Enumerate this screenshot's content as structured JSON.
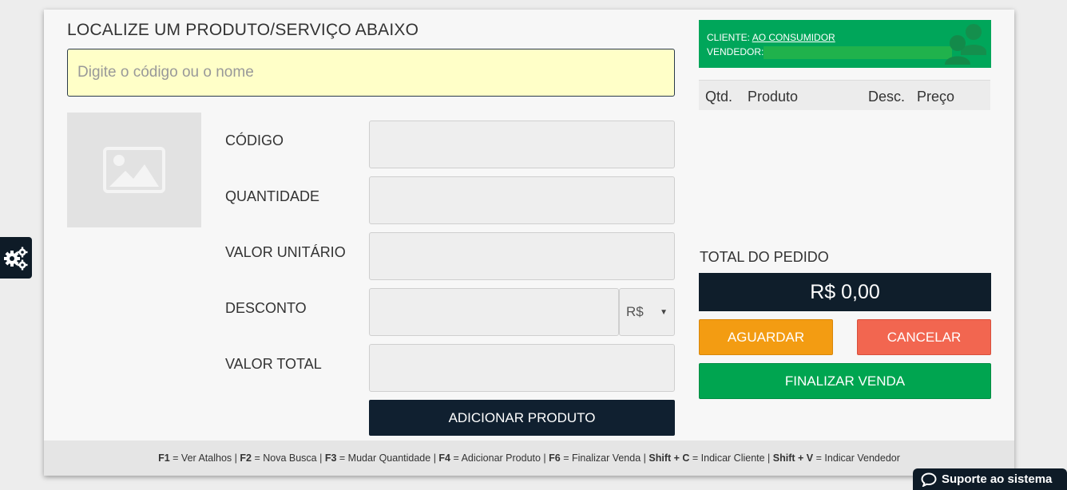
{
  "search": {
    "title": "LOCALIZE UM PRODUTO/SERVIÇO ABAIXO",
    "placeholder": "Digite o código ou o nome"
  },
  "fields": {
    "code_label": "CÓDIGO",
    "quantity_label": "QUANTIDADE",
    "unit_value_label": "VALOR UNITÁRIO",
    "discount_label": "DESCONTO",
    "total_value_label": "VALOR TOTAL",
    "discount_currency": "R$"
  },
  "add_button": "ADICIONAR PRODUTO",
  "client": {
    "client_label": "CLIENTE:",
    "client_name": "AO CONSUMIDOR",
    "seller_label": "VENDEDOR:"
  },
  "cart": {
    "columns": [
      "Qtd.",
      "Produto",
      "Desc.",
      "Preço"
    ]
  },
  "order": {
    "total_label": "TOTAL DO PEDIDO",
    "total_value": "R$ 0,00"
  },
  "buttons": {
    "wait": "AGUARDAR",
    "cancel": "CANCELAR",
    "finish": "FINALIZAR VENDA"
  },
  "shortcuts": [
    {
      "key": "F1",
      "desc": "Ver Atalhos"
    },
    {
      "key": "F2",
      "desc": "Nova Busca"
    },
    {
      "key": "F3",
      "desc": "Mudar Quantidade"
    },
    {
      "key": "F4",
      "desc": "Adicionar Produto"
    },
    {
      "key": "F6",
      "desc": "Finalizar Venda"
    },
    {
      "key": "Shift + C",
      "desc": "Indicar Cliente"
    },
    {
      "key": "Shift + V",
      "desc": "Indicar Vendedor"
    }
  ],
  "support": "Suporte ao sistema",
  "colors": {
    "search_bg": "#ffffc8",
    "client_green": "#00a65a",
    "dark_navy": "#0f1e2b",
    "wait_orange": "#f39c12",
    "cancel_red": "#f26650",
    "finish_green": "#00a550"
  },
  "icons": {
    "image_placeholder": "image-icon",
    "users": "users-icon",
    "settings": "gears-icon",
    "support": "chat-bubble-icon"
  }
}
